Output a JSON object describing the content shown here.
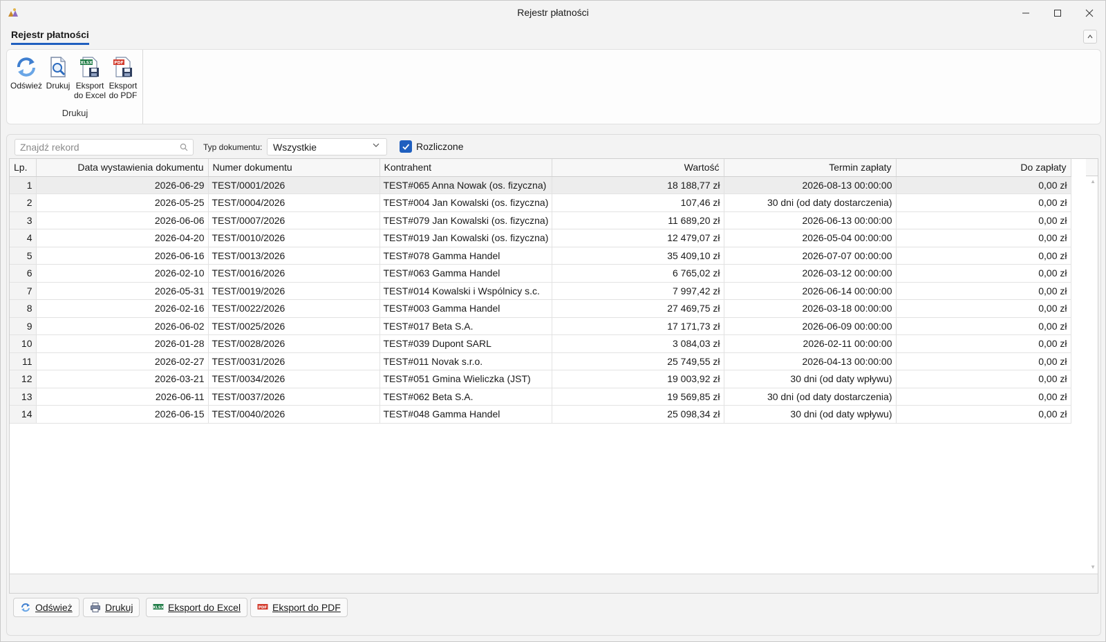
{
  "window": {
    "title": "Rejestr płatności"
  },
  "ribbon": {
    "tab_label": "Rejestr płatności",
    "group_label": "Drukuj",
    "buttons": {
      "refresh": [
        "Odśwież"
      ],
      "print": [
        "Drukuj"
      ],
      "excel": [
        "Eksport",
        "do Excel"
      ],
      "pdf": [
        "Eksport",
        "do PDF"
      ]
    }
  },
  "filters": {
    "search_placeholder": "Znajdź rekord",
    "doc_type_label": "Typ dokumentu:",
    "doc_type_value": "Wszystkie",
    "settled_label": "Rozliczone",
    "settled_checked": true
  },
  "table": {
    "columns": [
      "Lp.",
      "Data wystawienia dokumentu",
      "Numer dokumentu",
      "Kontrahent",
      "Wartość",
      "Termin zapłaty",
      "Do zapłaty"
    ],
    "rows": [
      [
        "1",
        "2026-06-29",
        "TEST/0001/2026",
        "TEST#065 Anna Nowak (os. fizyczna)",
        "18 188,77 zł",
        "2026-08-13 00:00:00",
        "0,00 zł"
      ],
      [
        "2",
        "2026-05-25",
        "TEST/0004/2026",
        "TEST#004 Jan Kowalski (os. fizyczna)",
        "107,46 zł",
        "30 dni (od daty dostarczenia)",
        "0,00 zł"
      ],
      [
        "3",
        "2026-06-06",
        "TEST/0007/2026",
        "TEST#079 Jan Kowalski (os. fizyczna)",
        "11 689,20 zł",
        "2026-06-13 00:00:00",
        "0,00 zł"
      ],
      [
        "4",
        "2026-04-20",
        "TEST/0010/2026",
        "TEST#019 Jan Kowalski (os. fizyczna)",
        "12 479,07 zł",
        "2026-05-04 00:00:00",
        "0,00 zł"
      ],
      [
        "5",
        "2026-06-16",
        "TEST/0013/2026",
        "TEST#078 Gamma Handel",
        "35 409,10 zł",
        "2026-07-07 00:00:00",
        "0,00 zł"
      ],
      [
        "6",
        "2026-02-10",
        "TEST/0016/2026",
        "TEST#063 Gamma Handel",
        "6 765,02 zł",
        "2026-03-12 00:00:00",
        "0,00 zł"
      ],
      [
        "7",
        "2026-05-31",
        "TEST/0019/2026",
        "TEST#014 Kowalski i Wspólnicy s.c.",
        "7 997,42 zł",
        "2026-06-14 00:00:00",
        "0,00 zł"
      ],
      [
        "8",
        "2026-02-16",
        "TEST/0022/2026",
        "TEST#003 Gamma Handel",
        "27 469,75 zł",
        "2026-03-18 00:00:00",
        "0,00 zł"
      ],
      [
        "9",
        "2026-06-02",
        "TEST/0025/2026",
        "TEST#017 Beta S.A.",
        "17 171,73 zł",
        "2026-06-09 00:00:00",
        "0,00 zł"
      ],
      [
        "10",
        "2026-01-28",
        "TEST/0028/2026",
        "TEST#039 Dupont SARL",
        "3 084,03 zł",
        "2026-02-11 00:00:00",
        "0,00 zł"
      ],
      [
        "11",
        "2026-02-27",
        "TEST/0031/2026",
        "TEST#011 Novak s.r.o.",
        "25 749,55 zł",
        "2026-04-13 00:00:00",
        "0,00 zł"
      ],
      [
        "12",
        "2026-03-21",
        "TEST/0034/2026",
        "TEST#051 Gmina Wieliczka (JST)",
        "19 003,92 zł",
        "30 dni (od daty wpływu)",
        "0,00 zł"
      ],
      [
        "13",
        "2026-06-11",
        "TEST/0037/2026",
        "TEST#062 Beta S.A.",
        "19 569,85 zł",
        "30 dni (od daty dostarczenia)",
        "0,00 zł"
      ],
      [
        "14",
        "2026-06-15",
        "TEST/0040/2026",
        "TEST#048 Gamma Handel",
        "25 098,34 zł",
        "30 dni (od daty wpływu)",
        "0,00 zł"
      ]
    ]
  },
  "bottom_buttons": {
    "refresh": "Odśwież",
    "print": "Drukuj",
    "excel": "Eksport do Excel",
    "pdf": "Eksport do PDF"
  },
  "icons": {
    "excel_badge": "XLSX",
    "pdf_badge": "PDF"
  },
  "colors": {
    "accent": "#1f5fbf",
    "excel_green": "#1e7b45",
    "pdf_red": "#d23a2b"
  }
}
